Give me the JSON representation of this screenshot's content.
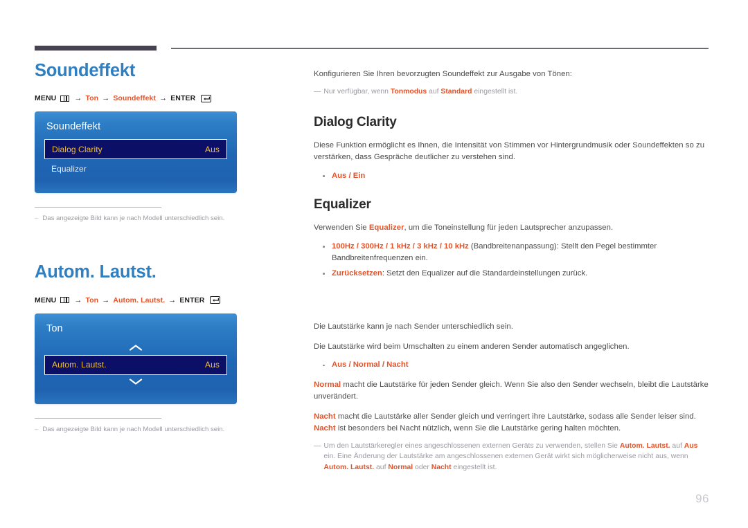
{
  "page": {
    "number": "96"
  },
  "left": {
    "section1": {
      "title": "Soundeffekt",
      "breadcrumb": {
        "menu": "MENU",
        "menu_icon": "menu-grid-icon",
        "arrow": "→",
        "item1": "Ton",
        "item2": "Soundeffekt",
        "enter": "ENTER",
        "enter_icon": "enter-key-icon"
      },
      "osd": {
        "title": "Soundeffekt",
        "rows": [
          {
            "label": "Dialog Clarity",
            "value": "Aus",
            "selected": true
          },
          {
            "label": "Equalizer",
            "value": "",
            "selected": false
          }
        ]
      },
      "footnote": "Das angezeigte Bild kann je nach Modell unterschiedlich sein.",
      "footnote_dash": "–"
    },
    "section2": {
      "title": "Autom. Lautst.",
      "breadcrumb": {
        "menu": "MENU",
        "menu_icon": "menu-grid-icon",
        "arrow": "→",
        "item1": "Ton",
        "item2": "Autom. Lautst.",
        "enter": "ENTER",
        "enter_icon": "enter-key-icon"
      },
      "osd": {
        "title": "Ton",
        "chevron_up": "chevron-up-icon",
        "chevron_down": "chevron-down-icon",
        "rows": [
          {
            "label": "Autom. Lautst.",
            "value": "Aus",
            "selected": true
          }
        ]
      },
      "footnote": "Das angezeigte Bild kann je nach Modell unterschiedlich sein.",
      "footnote_dash": "–"
    }
  },
  "right": {
    "intro": "Konfigurieren Sie Ihren bevorzugten Soundeffekt zur Ausgabe von Tönen:",
    "intro_note": {
      "dash": "—",
      "t1": "Nur verfügbar, wenn ",
      "a1": "Tonmodus",
      "t2": " auf ",
      "a2": "Standard",
      "t3": " eingestellt ist."
    },
    "dialog_clarity": {
      "heading": "Dialog Clarity",
      "body": "Diese Funktion ermöglicht es Ihnen, die Intensität von Stimmen vor Hintergrundmusik oder Soundeffekten so zu verstärken, dass Gespräche deutlicher zu verstehen sind.",
      "options": "Aus / Ein"
    },
    "equalizer": {
      "heading": "Equalizer",
      "body_pre": "Verwenden Sie ",
      "body_accent": "Equalizer",
      "body_post": ", um die Toneinstellung für jeden Lautsprecher anzupassen.",
      "bullet1_accent": "100Hz / 300Hz / 1 kHz / 3 kHz / 10 kHz",
      "bullet1_text": " (Bandbreitenanpassung): Stellt den Pegel bestimmter Bandbreitenfrequenzen ein.",
      "bullet2_accent": "Zurücksetzen",
      "bullet2_text": ": Setzt den Equalizer auf die Standardeinstellungen zurück."
    },
    "auto_volume": {
      "p1": "Die Lautstärke kann je nach Sender unterschiedlich sein.",
      "p2": "Die Lautstärke wird beim Umschalten zu einem anderen Sender automatisch angeglichen.",
      "options": "Aus / Normal / Nacht",
      "p3_accent": "Normal",
      "p3_text": " macht die Lautstärke für jeden Sender gleich. Wenn Sie also den Sender wechseln, bleibt die Lautstärke unverändert.",
      "p4_accent1": "Nacht",
      "p4_text1": " macht die Lautstärke aller Sender gleich und verringert ihre Lautstärke, sodass alle Sender leiser sind. ",
      "p4_accent2": "Nacht",
      "p4_text2": " ist besonders bei Nacht nützlich, wenn Sie die Lautstärke gering halten möchten.",
      "note": {
        "dash": "—",
        "t1": "Um den Lautstärkeregler eines angeschlossenen externen Geräts zu verwenden, stellen Sie ",
        "a1": "Autom. Lautst.",
        "t2": " auf ",
        "a2": "Aus",
        "t3": " ein. Eine Änderung der Lautstärke am angeschlossenen externen Gerät wirkt sich möglicherweise nicht aus, wenn ",
        "a3": "Autom. Lautst.",
        "t4": " auf ",
        "a4": "Normal",
        "t5": " oder ",
        "a5": "Nacht",
        "t6": " eingestellt ist."
      }
    }
  }
}
